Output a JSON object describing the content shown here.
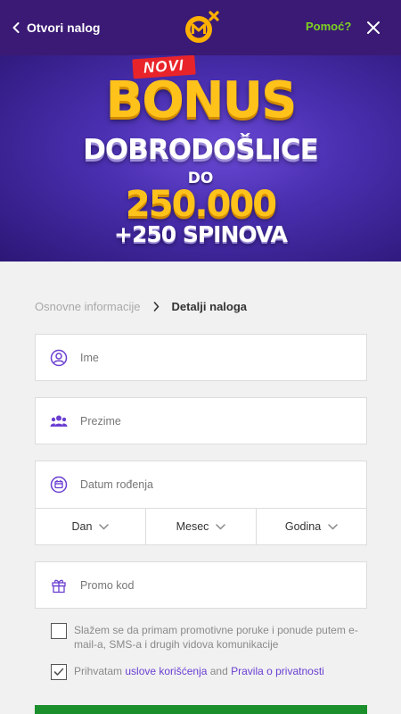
{
  "header": {
    "back_label": "Otvori nalog",
    "help_label": "Pomoć?",
    "accent_color": "#7ed321",
    "bg_color": "#3a1a74"
  },
  "banner": {
    "badge": "NOVI",
    "line1": "BONUS",
    "line2": "DOBRODOŠLICE",
    "line3": "DO",
    "amount": "250.000",
    "line5": "+250 SPINOVA"
  },
  "steps": {
    "step1": "Osnovne informacije",
    "step2": "Detalji naloga"
  },
  "form": {
    "first_name_placeholder": "Ime",
    "last_name_placeholder": "Prezime",
    "dob_placeholder": "Datum rođenja",
    "day_label": "Dan",
    "month_label": "Mesec",
    "year_label": "Godina",
    "promo_placeholder": "Promo kod"
  },
  "consents": {
    "marketing_text": "Slažem se da primam promotivne poruke i ponude putem e-mail-a, SMS-a i drugih vidova komunikacije",
    "marketing_checked": false,
    "terms_prefix": "Prihvatam ",
    "terms_link": "uslove korišćenja",
    "terms_and": " and ",
    "privacy_link": "Pravila o privatnosti",
    "terms_checked": true
  },
  "icons": {
    "back": "chevron-left-icon",
    "close": "close-icon",
    "user": "user-circle-icon",
    "group": "group-icon",
    "calendar": "calendar-icon",
    "gift": "gift-icon",
    "chevron_down": "chevron-down-icon"
  }
}
